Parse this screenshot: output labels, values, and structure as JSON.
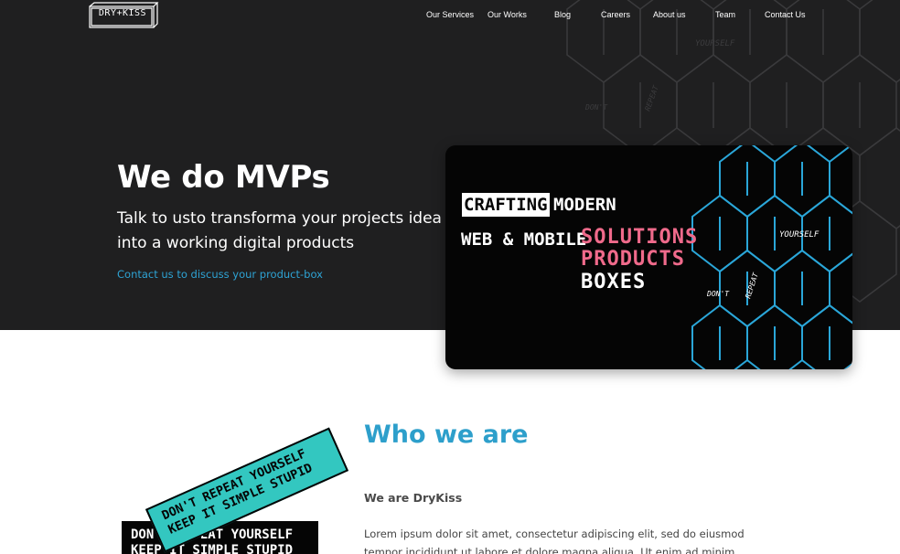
{
  "logo": {
    "text": "DRY+KISS"
  },
  "nav": {
    "items": [
      "Our Services",
      "Our Works",
      "Blog",
      "Careers",
      "About us",
      "Team",
      "Contact Us"
    ]
  },
  "hero": {
    "title": "We do MVPs",
    "subtitle": "Talk to usto transforma your projects idea into a working digital products",
    "link": "Contact us to discuss your product-box",
    "pattern_words": [
      "YOURSELF",
      "DON'T",
      "REPEAT"
    ]
  },
  "banner": {
    "crafting": "CRAFTING",
    "modern": "MODERN",
    "web_mobile": "WEB & MOBILE",
    "solutions": "SOLUTIONS",
    "products": "PRODUCTS",
    "boxes": "BOXES",
    "cube_words": {
      "yourself": "YOURSELF",
      "dont": "DON'T",
      "repeat": "REPEAT"
    }
  },
  "who": {
    "title": "Who we are",
    "subtitle": "We are DryKiss",
    "body": "Lorem ipsum dolor sit amet, consectetur adipiscing elit, sed do eiusmod tempor incididunt ut labore et dolore magna aliqua. Ut enim ad minim veniam, quis"
  },
  "stickers": {
    "teal_line1": "DON'T REPEAT YOURSELF",
    "teal_line2": "KEEP IT SIMPLE STUPID",
    "black_line1": "DON'T REPEAT YOURSELF",
    "black_line2": "KEEP IT SIMPLE STUPID"
  },
  "colors": {
    "hero_bg": "#1f1f20",
    "accent_blue": "#2d9fcb",
    "pink": "#f06a8b",
    "teal": "#33c7c0"
  }
}
